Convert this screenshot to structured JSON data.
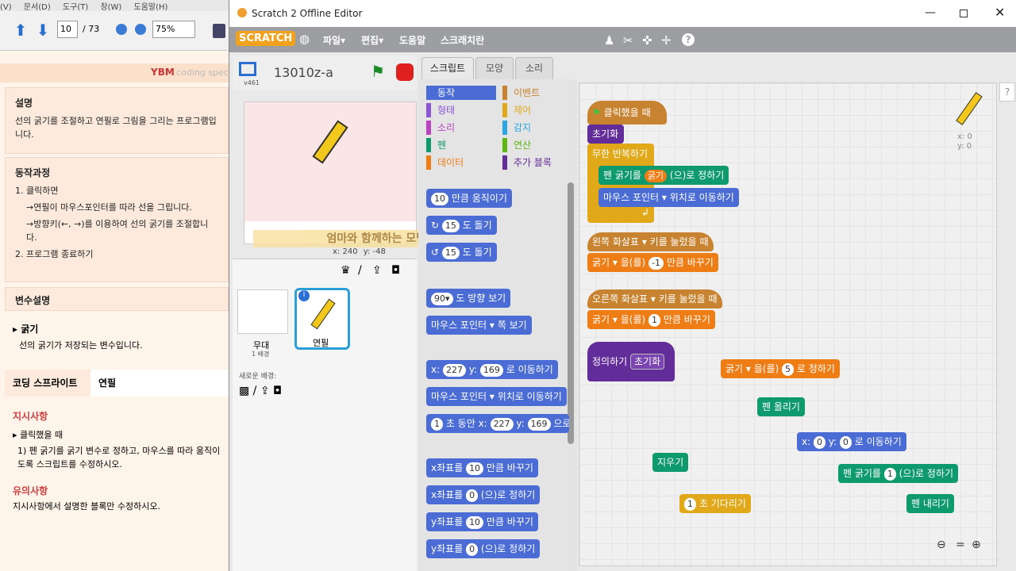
{
  "pdf": {
    "menu": [
      "(V)",
      "문서(D)",
      "도구(T)",
      "창(W)",
      "도움말(H)"
    ],
    "page_current": "10",
    "page_total": "/ 73",
    "zoom": "75%",
    "brand": "coding spec",
    "s1_title": "설명",
    "s1_body": "선의 굵기를 조절하고 연필로 그림을 그리는 프로그램입니다.",
    "s2_title": "동작과정",
    "s2_1": "1.  클릭하면",
    "s2_1a": "→연필이 마우스포인터를 따라 선을 그립니다.",
    "s2_1b": "→방향키(←, →)를 이용하여 선의 굵기를 조절합니다.",
    "s2_2": "2.  프로그램 종료하기",
    "s3_title": "변수설명",
    "s3_var": "▸ 굵기",
    "s3_body": "선의 굵기가 저장되는 변수입니다.",
    "s4_tab1": "코딩 스프라이트",
    "s4_tab2": "연필",
    "s4_inst": "지시사항",
    "s4_when": "▸  클릭했을 때",
    "s4_inst_body": "1) 펜 굵기를 굵기 변수로 정하고, 마우스를 따라 움직이도록 스크립트를 수정하시오.",
    "s4_note": "유의사항",
    "s4_note_body": "지시사항에서 설명한 블록만 수정하시오."
  },
  "window": {
    "title": "Scratch 2 Offline Editor"
  },
  "menubar": {
    "logo": "SCRATCH",
    "items": [
      "파일▾",
      "편집▾",
      "도움말",
      "스크래치란"
    ]
  },
  "stage": {
    "name": "13010z-a",
    "version": "v461",
    "x_label": "x:",
    "x": "240",
    "y_label": "y:",
    "y": "-48",
    "watermark": "엄마와 함께하는 모범적인 선문가"
  },
  "sprites": {
    "stage_label": "무대",
    "stage_sub": "1 배경",
    "sprite_label": "연필",
    "new_bg": "새로운 배경:"
  },
  "tabs": [
    "스크립트",
    "모양",
    "소리"
  ],
  "categories": [
    {
      "label": "동작",
      "color": "#4a6cd4"
    },
    {
      "label": "이벤트",
      "color": "#c88330"
    },
    {
      "label": "형태",
      "color": "#8a55d7"
    },
    {
      "label": "제어",
      "color": "#e1a91a"
    },
    {
      "label": "소리",
      "color": "#bb42c3"
    },
    {
      "label": "감지",
      "color": "#2ca5e2"
    },
    {
      "label": "펜",
      "color": "#0e9a6c"
    },
    {
      "label": "연산",
      "color": "#5cb712"
    },
    {
      "label": "데이터",
      "color": "#ee7d16"
    },
    {
      "label": "추가 블록",
      "color": "#632d99"
    }
  ],
  "palette": {
    "b1": "10",
    "b1t": "만큼 움직이기",
    "b2": "15",
    "b2t": "도 돌기",
    "b3": "15",
    "b3t": "도 돌기",
    "b4": "90▾",
    "b4t": "도 방향 보기",
    "b5": "마우스 포인터 ▾",
    "b5t": "쪽 보기",
    "b6a": "x:",
    "b6x": "227",
    "b6b": "y:",
    "b6y": "169",
    "b6t": "로 이동하기",
    "b7": "마우스 포인터 ▾",
    "b7t": "위치로 이동하기",
    "b8": "1",
    "b8a": "초 동안 x:",
    "b8x": "227",
    "b8b": "y:",
    "b8y": "169",
    "b8t": "으로",
    "b9a": "x좌표를",
    "b9": "10",
    "b9t": "만큼 바꾸기",
    "b10a": "x좌표를",
    "b10": "0",
    "b10t": "(으)로 정하기",
    "b11a": "y좌표를",
    "b11": "10",
    "b11t": "만큼 바꾸기",
    "b12a": "y좌표를",
    "b12": "0",
    "b12t": "(으)로 정하기"
  },
  "scripts": {
    "s1_hat": "클릭했을 때",
    "s1_init": "초기화",
    "s1_forever": "무한 반복하기",
    "s1_pen_a": "펜 굵기를",
    "s1_pen_var": "굵기",
    "s1_pen_b": "(으)로 정하기",
    "s1_go": "마우스 포인터 ▾",
    "s1_go_t": "위치로 이동하기",
    "s2_hat": "왼쪽 화살표 ▾ 키를 눌렀을 때",
    "s2_var": "굵기 ▾",
    "s2_a": "을(를)",
    "s2_val": "-1",
    "s2_b": "만큼 바꾸기",
    "s3_hat": "오른쪽 화살표 ▾ 키를 눌렀을 때",
    "s3_var": "굵기 ▾",
    "s3_a": "을(를)",
    "s3_val": "1",
    "s3_b": "만큼 바꾸기",
    "def_a": "정의하기",
    "def_b": "초기화",
    "set_var": "굵기 ▾",
    "set_a": "을(를)",
    "set_val": "5",
    "set_b": "로 정하기",
    "penup": "펜 올리기",
    "goto_a": "x:",
    "goto_x": "0",
    "goto_b": "y:",
    "goto_y": "0",
    "goto_t": "로 이동하기",
    "clear": "지우기",
    "pensize_a": "펜 굵기를",
    "pensize_v": "1",
    "pensize_b": "(으)로 정하기",
    "wait_v": "1",
    "wait_t": "초 기다리기",
    "pendown": "펜 내리기",
    "coord_x": "x: 0",
    "coord_y": "y: 0"
  }
}
